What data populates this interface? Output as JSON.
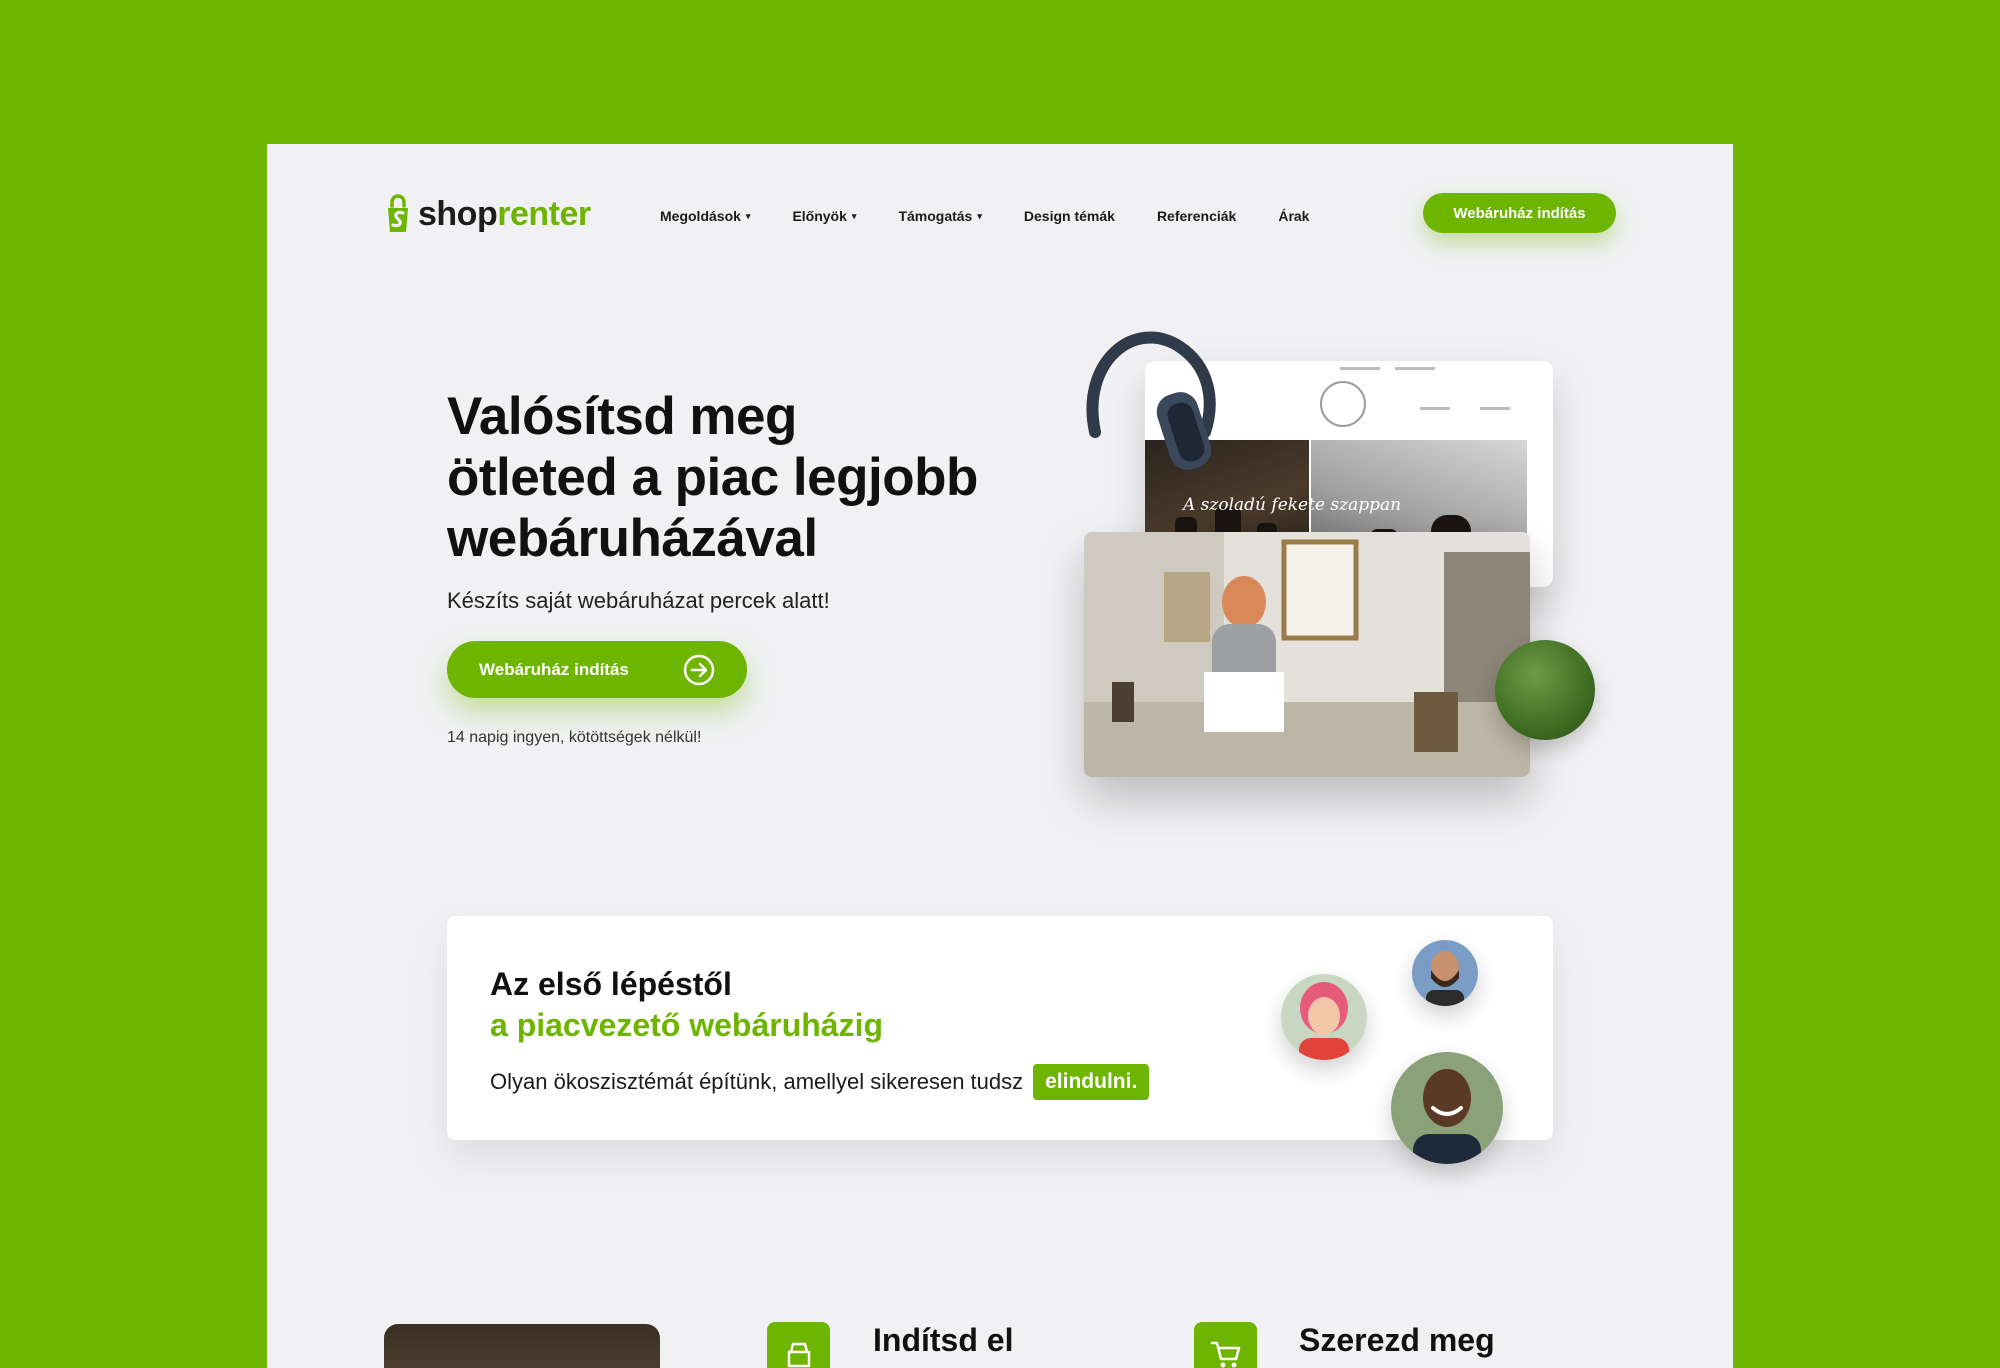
{
  "brand": {
    "shop": "shop",
    "renter": "renter",
    "accent": "#6db501"
  },
  "nav": {
    "items": [
      {
        "label": "Megoldások",
        "dropdown": true
      },
      {
        "label": "Előnyök",
        "dropdown": true
      },
      {
        "label": "Támogatás",
        "dropdown": true
      },
      {
        "label": "Design témák",
        "dropdown": false
      },
      {
        "label": "Referenciák",
        "dropdown": false
      },
      {
        "label": "Árak",
        "dropdown": false
      }
    ],
    "cta": "Webáruház indítás"
  },
  "hero": {
    "title_line1": "Valósítsd meg",
    "title_line2": "ötleted a piac legjobb",
    "title_line3": "webáruházával",
    "subtitle": "Készíts saját webáruházat percek alatt!",
    "cta": "Webáruház indítás",
    "note": "14 napig ingyen, kötöttségek nélkül!",
    "screenshot_caption": "A szoladú fekete szappan"
  },
  "info_card": {
    "title": "Az első lépéstől",
    "title_green": "a piacvezető webáruházig",
    "text": "Olyan ökoszisztémát építünk, amellyel sikeresen tudsz",
    "badge": "elindulni."
  },
  "features": [
    {
      "title": "Indítsd el",
      "icon": "shop-icon"
    },
    {
      "title": "Szerezd meg",
      "icon": "cart-icon"
    }
  ]
}
